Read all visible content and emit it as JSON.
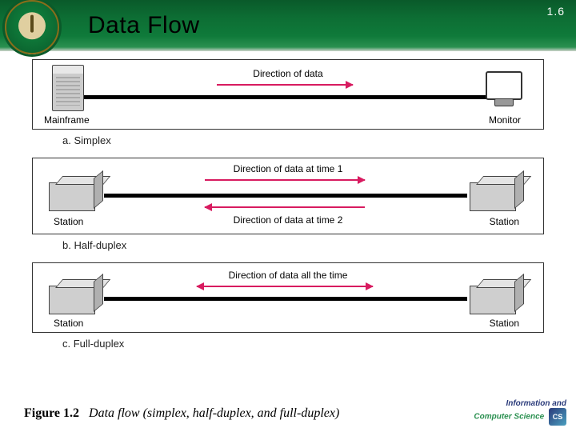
{
  "header": {
    "title": "Data Flow",
    "page_number": "1.6"
  },
  "figure": {
    "number": "Figure 1.2",
    "caption": "Data flow (simplex, half-duplex, and full-duplex)"
  },
  "panels": {
    "simplex": {
      "caption": "a. Simplex",
      "left_device": "Mainframe",
      "right_device": "Monitor",
      "arrow_label": "Direction of data"
    },
    "half": {
      "caption": "b. Half-duplex",
      "left_device": "Station",
      "right_device": "Station",
      "arrow_label_top": "Direction of data at time 1",
      "arrow_label_bottom": "Direction of data at time 2"
    },
    "full": {
      "caption": "c. Full-duplex",
      "left_device": "Station",
      "right_device": "Station",
      "arrow_label": "Direction of data all the time"
    }
  },
  "footer": {
    "line1": "Information and",
    "line2": "Computer Science",
    "badge": "CS"
  }
}
